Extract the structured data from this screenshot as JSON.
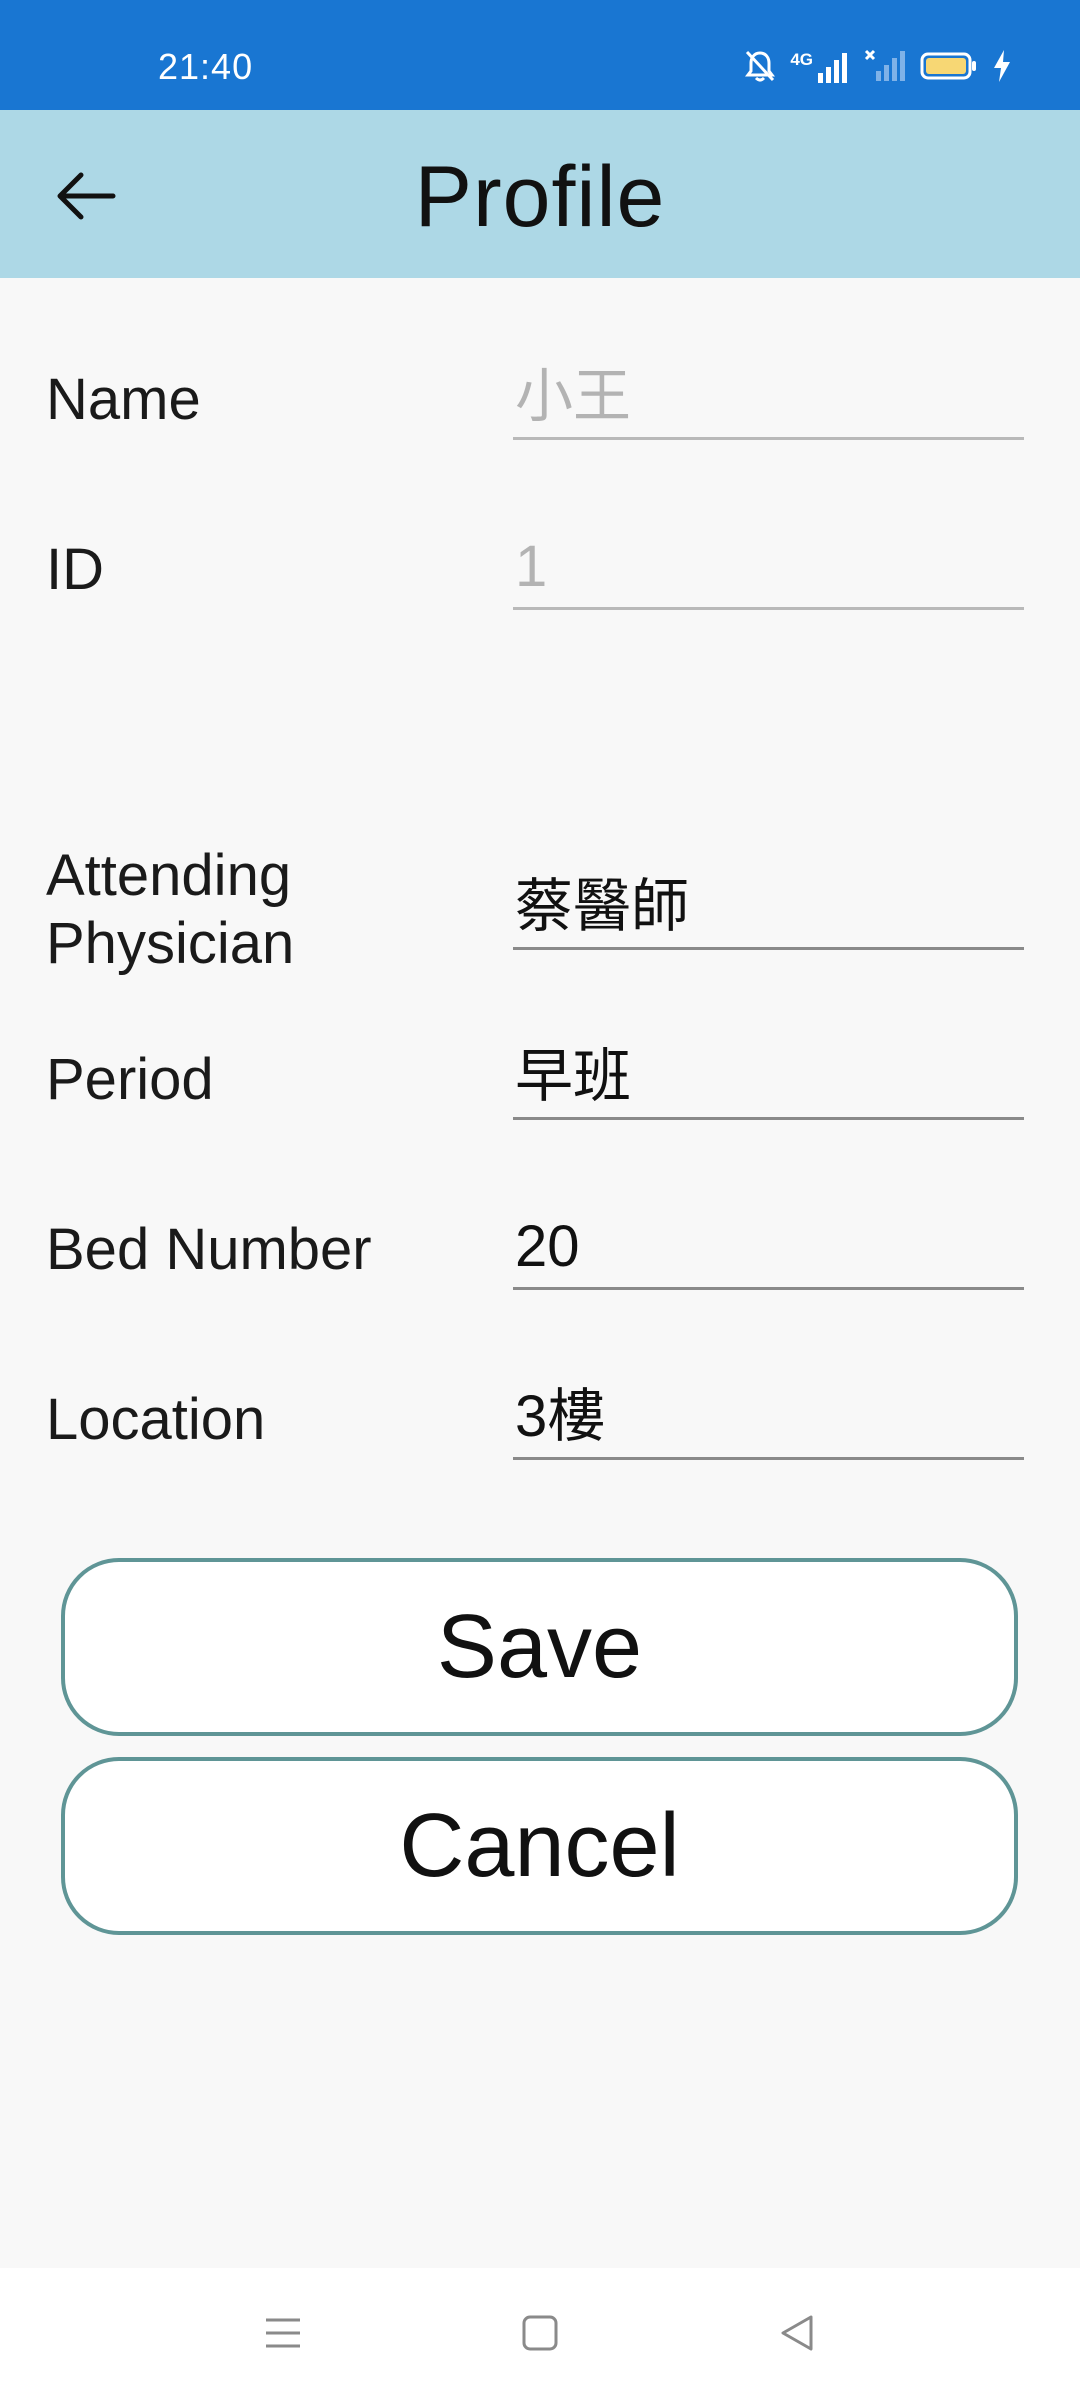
{
  "status_bar": {
    "time": "21:40",
    "network_label": "4G",
    "icons": [
      "bell-off-icon",
      "signal-4g-icon",
      "signal-no-sim-icon",
      "battery-icon",
      "charging-icon"
    ]
  },
  "app_bar": {
    "title": "Profile",
    "back_icon": "arrow-left-icon"
  },
  "form": {
    "name": {
      "label": "Name",
      "value": "小王"
    },
    "id": {
      "label": "ID",
      "value": "1"
    },
    "physician": {
      "label_line1": "Attending",
      "label_line2": "Physician",
      "value": "蔡醫師"
    },
    "period": {
      "label": "Period",
      "value": "早班"
    },
    "bed": {
      "label": "Bed Number",
      "value": "20"
    },
    "location": {
      "label": "Location",
      "value": "3樓"
    }
  },
  "buttons": {
    "save": "Save",
    "cancel": "Cancel"
  },
  "nav_bar": {
    "icons": [
      "menu-icon",
      "home-square-icon",
      "back-triangle-icon"
    ]
  },
  "colors": {
    "status_bar": "#1976d2",
    "app_bar": "#add8e6",
    "button_border": "#5f9596",
    "background": "#f8f8f8"
  }
}
